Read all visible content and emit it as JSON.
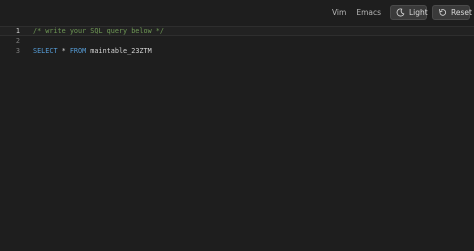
{
  "toolbar": {
    "vim_label": "Vim",
    "emacs_label": "Emacs",
    "light_label": "Light",
    "reset_label": "Reset",
    "light_icon": "moon-icon",
    "reset_icon": "reset-icon"
  },
  "editor": {
    "lines": [
      {
        "number": "1",
        "comment": "/* write your SQL query below */"
      },
      {
        "number": "2"
      },
      {
        "number": "3",
        "keyword1": "SELECT",
        "star": " * ",
        "keyword2": "FROM",
        "table": " maintable_23ZTM"
      }
    ]
  },
  "colors": {
    "background": "#1e1e1e",
    "comment": "#6f9955",
    "keyword": "#569cd6",
    "text": "#d4d4d4"
  }
}
